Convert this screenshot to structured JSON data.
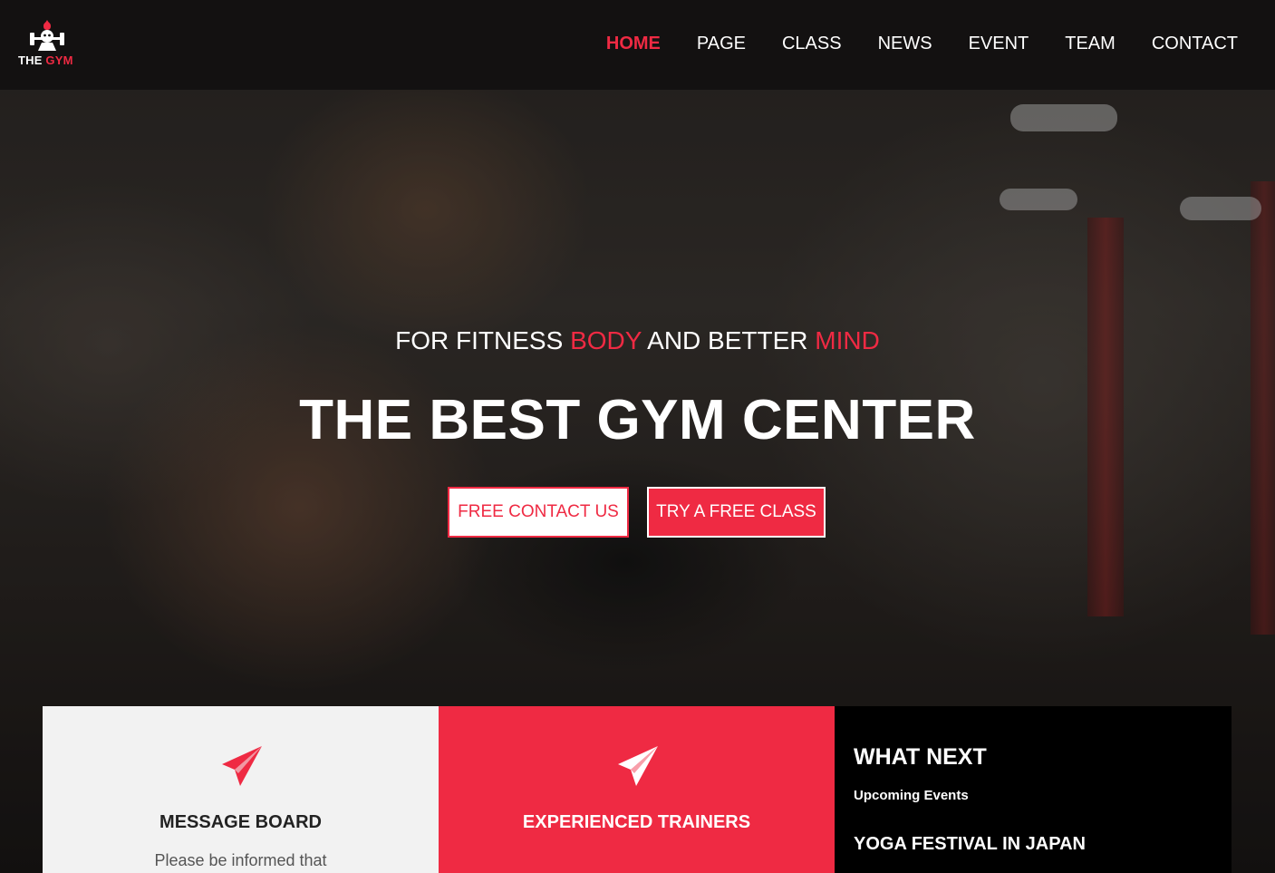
{
  "brand": {
    "name_part1": "THE ",
    "name_part2": "GYM",
    "accent_color": "#ef2a43"
  },
  "nav": {
    "items": [
      {
        "label": "HOME",
        "active": true
      },
      {
        "label": "PAGE",
        "active": false
      },
      {
        "label": "CLASS",
        "active": false
      },
      {
        "label": "NEWS",
        "active": false
      },
      {
        "label": "EVENT",
        "active": false
      },
      {
        "label": "TEAM",
        "active": false
      },
      {
        "label": "CONTACT",
        "active": false
      }
    ]
  },
  "hero": {
    "tagline_1": "FOR FITNESS ",
    "tagline_2": "BODY",
    "tagline_3": " AND BETTER ",
    "tagline_4": "MIND",
    "headline": "THE BEST GYM CENTER",
    "button_primary": "FREE CONTACT US",
    "button_secondary": "TRY A FREE CLASS"
  },
  "cards": {
    "message_board": {
      "icon": "paper-plane-icon",
      "title": "MESSAGE BOARD",
      "text": "Please be informed that"
    },
    "trainers": {
      "icon": "paper-plane-icon",
      "title": "EXPERIENCED TRAINERS",
      "text": ""
    },
    "what_next": {
      "title": "WHAT NEXT",
      "subtitle": "Upcoming Events",
      "event": "YOGA FESTIVAL IN JAPAN"
    }
  }
}
